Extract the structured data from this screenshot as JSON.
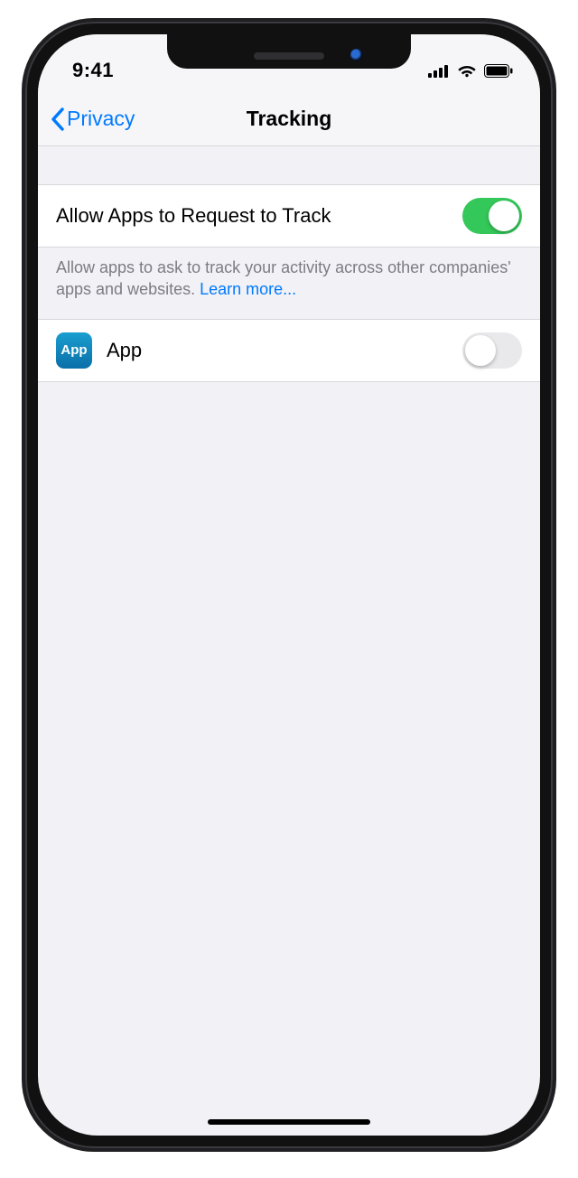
{
  "status": {
    "time": "9:41"
  },
  "nav": {
    "back_label": "Privacy",
    "title": "Tracking"
  },
  "settings": {
    "allow_label": "Allow Apps to Request to Track",
    "allow_on": true,
    "footer_text": "Allow apps to ask to track your activity across other companies' apps and websites. ",
    "learn_more": "Learn more..."
  },
  "apps": [
    {
      "icon_text": "App",
      "name": "App",
      "on": false
    }
  ]
}
